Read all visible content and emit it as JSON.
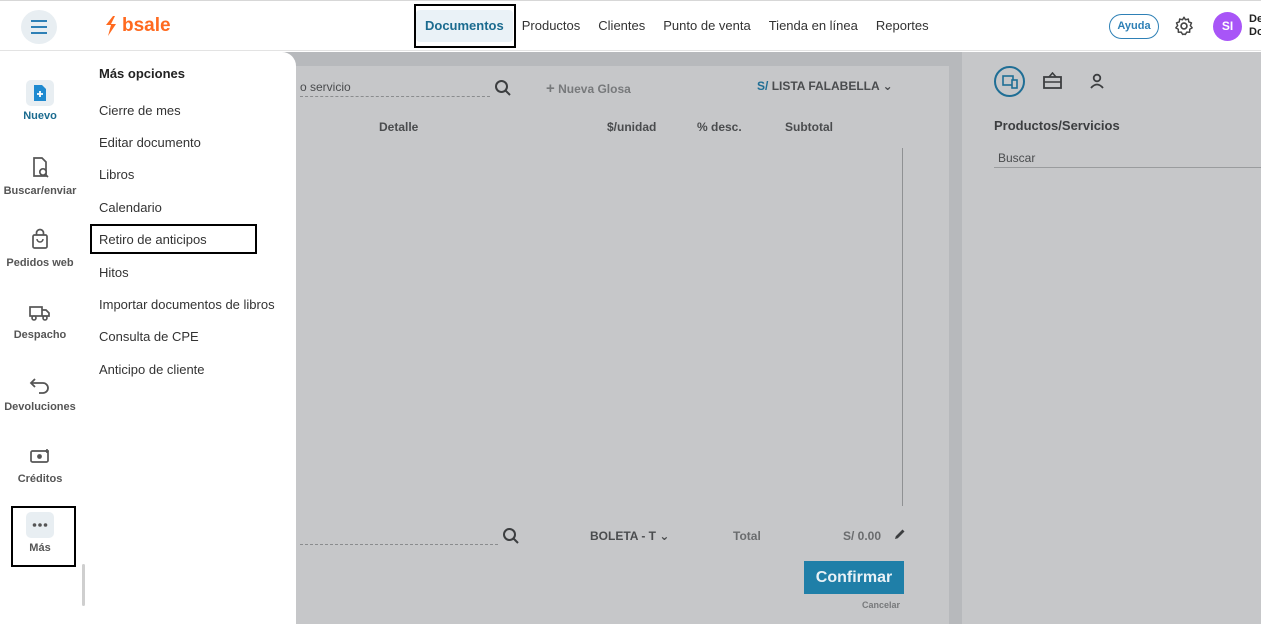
{
  "header": {
    "logo_text": "bsale",
    "nav": [
      "Documentos",
      "Productos",
      "Clientes",
      "Punto de venta",
      "Tienda en línea",
      "Reportes"
    ],
    "active_nav": "Documentos",
    "help_label": "Ayuda",
    "avatar_initials": "SI",
    "user_name_line1": "De",
    "user_name_line2": "Do"
  },
  "sidebar": {
    "items": [
      {
        "label": "Nuevo",
        "icon": "new-document-icon"
      },
      {
        "label": "Buscar/enviar",
        "icon": "document-search-icon"
      },
      {
        "label": "Pedidos web",
        "icon": "shopping-bag-icon"
      },
      {
        "label": "Despacho",
        "icon": "truck-icon"
      },
      {
        "label": "Devoluciones",
        "icon": "return-arrow-icon"
      },
      {
        "label": "Créditos",
        "icon": "money-credit-icon"
      },
      {
        "label": "Más",
        "icon": "more-dots-icon"
      }
    ]
  },
  "menu": {
    "title": "Más opciones",
    "items": [
      "Cierre de mes",
      "Editar documento",
      "Libros",
      "Calendario",
      "Retiro de anticipos",
      "Hitos",
      "Importar documentos de libros",
      "Consulta de CPE",
      "Anticipo de cliente"
    ]
  },
  "document": {
    "search_placeholder_fragment": "o servicio",
    "new_gloss_label": "Nueva Glosa",
    "price_list_prefix": "S/",
    "price_list": "LISTA FALABELLA",
    "columns": [
      "Detalle",
      "$/unidad",
      "% desc.",
      "Subtotal"
    ],
    "doc_type": "BOLETA - T",
    "total_label": "Total",
    "total_value": "S/ 0.00",
    "confirm_label": "Confirmar",
    "cancel_label": "Cancelar"
  },
  "side_panel": {
    "title": "Productos/Servicios",
    "search_placeholder": "Buscar"
  },
  "colors": {
    "brand_orange": "#ff6a1f",
    "accent_blue": "#2e80b6",
    "confirm_blue": "#1f7fa8",
    "avatar_purple": "#a855f7"
  }
}
